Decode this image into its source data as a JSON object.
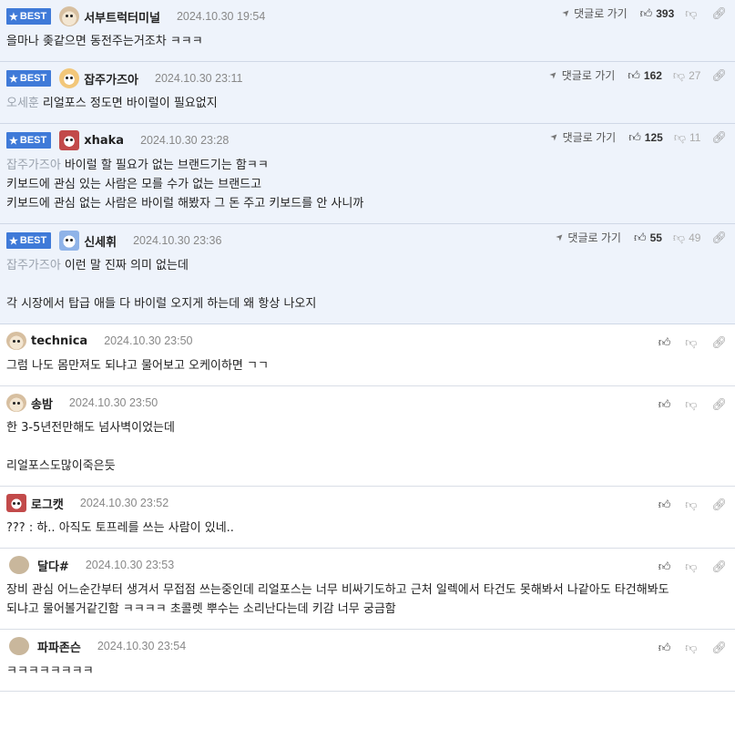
{
  "ui": {
    "best_label": "BEST",
    "reply_label": "댓글로 가기"
  },
  "comments": [
    {
      "best": true,
      "avatar": "dog",
      "nick": "서부트럭터미널",
      "date": "2024.10.30 19:54",
      "likes": "393",
      "dislikes": "",
      "mention": "",
      "lines": [
        "을마나 좆같으면 동전주는거조차 ㅋㅋㅋ"
      ]
    },
    {
      "best": true,
      "avatar": "fox",
      "nick": "잡주가즈아",
      "date": "2024.10.30 23:11",
      "likes": "162",
      "dislikes": "27",
      "mention": "오세훈",
      "lines": [
        "리얼포스 정도면 바이럴이 필요없지"
      ]
    },
    {
      "best": true,
      "avatar": "red",
      "nick": "xhaka",
      "date": "2024.10.30 23:28",
      "likes": "125",
      "dislikes": "11",
      "mention": "잡주가즈아",
      "lines": [
        "바이럴 할 필요가 없는 브랜드기는 함ㅋㅋ",
        "키보드에 관심 있는 사람은 모를 수가 없는 브랜드고",
        "키보드에 관심 없는 사람은 바이럴 해봤자 그 돈 주고 키보드를 안 사니까"
      ]
    },
    {
      "best": true,
      "avatar": "blue",
      "nick": "신세휘",
      "date": "2024.10.30 23:36",
      "likes": "55",
      "dislikes": "49",
      "mention": "잡주가즈아",
      "lines": [
        "이런 말 진짜 의미 없는데",
        "",
        "각 시장에서 탑급 애들 다 바이럴 오지게 하는데 왜 항상 나오지"
      ]
    },
    {
      "best": false,
      "avatar": "dog",
      "nick": "technica",
      "date": "2024.10.30 23:50",
      "likes": "",
      "dislikes": "",
      "mention": "",
      "lines": [
        "그럼 나도 몸만져도 되냐고 물어보고 오케이하면 ㄱㄱ"
      ]
    },
    {
      "best": false,
      "avatar": "dog",
      "nick": "송밤",
      "date": "2024.10.30 23:50",
      "likes": "",
      "dislikes": "",
      "mention": "",
      "lines": [
        "한 3-5년전만해도 넘사벽이었는데",
        "",
        "리얼포스도많이죽은듯"
      ]
    },
    {
      "best": false,
      "avatar": "red",
      "nick": "로그캣",
      "date": "2024.10.30 23:52",
      "likes": "",
      "dislikes": "",
      "mention": "",
      "lines": [
        "??? : 하.. 아직도 토프레를 쓰는 사람이 있네.."
      ]
    },
    {
      "best": false,
      "avatar": "plain",
      "nick": "달다#",
      "date": "2024.10.30 23:53",
      "likes": "",
      "dislikes": "",
      "mention": "",
      "lines": [
        "장비 관심 어느순간부터 생겨서 무접점 쓰는중인데 리얼포스는 너무 비싸기도하고 근처 일렉에서 타건도 못해봐서 나같아도 타건해봐도",
        "되냐고 물어볼거같긴함 ㅋㅋㅋㅋ 초콜렛 뿌수는 소리난다는데 키감 너무 궁금함"
      ]
    },
    {
      "best": false,
      "avatar": "plain",
      "nick": "파파존슨",
      "date": "2024.10.30 23:54",
      "likes": "",
      "dislikes": "",
      "mention": "",
      "lines": [
        "ㅋㅋㅋㅋㅋㅋㅋㅋ"
      ]
    }
  ]
}
